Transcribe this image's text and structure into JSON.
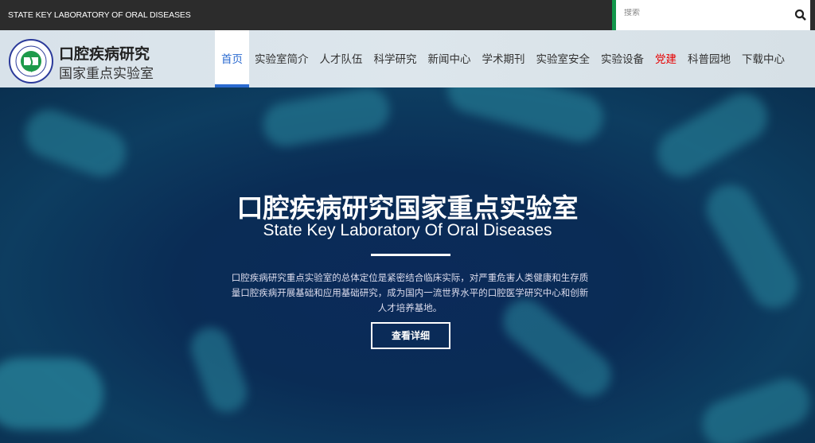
{
  "topbar": {
    "site_name_en": "STATE KEY LABORATORY OF ORAL DISEASES",
    "search_placeholder": "搜索"
  },
  "header": {
    "logo_line1": "口腔疾病研究",
    "logo_line2": "国家重点实验室"
  },
  "nav": {
    "items": [
      {
        "label": "首页",
        "active": true
      },
      {
        "label": "实验室简介"
      },
      {
        "label": "人才队伍"
      },
      {
        "label": "科学研究"
      },
      {
        "label": "新闻中心"
      },
      {
        "label": "学术期刊"
      },
      {
        "label": "实验室安全"
      },
      {
        "label": "实验设备"
      },
      {
        "label": "党建",
        "color": "#e60000"
      },
      {
        "label": "科普园地"
      },
      {
        "label": "下载中心"
      }
    ]
  },
  "hero": {
    "title": "口腔疾病研究国家重点实验室",
    "subtitle": "State Key Laboratory Of Oral Diseases",
    "description": "口腔疾病研究重点实验室的总体定位是紧密结合临床实际，对严重危害人类健康和生存质量口腔疾病开展基础和应用基础研究，成为国内一流世界水平的口腔医学研究中心和创新人才培养基地。",
    "button_label": "查看详细"
  },
  "colors": {
    "accent": "#2a6ad0",
    "search_border": "#12964a",
    "topbar": "#2c2c2c"
  }
}
